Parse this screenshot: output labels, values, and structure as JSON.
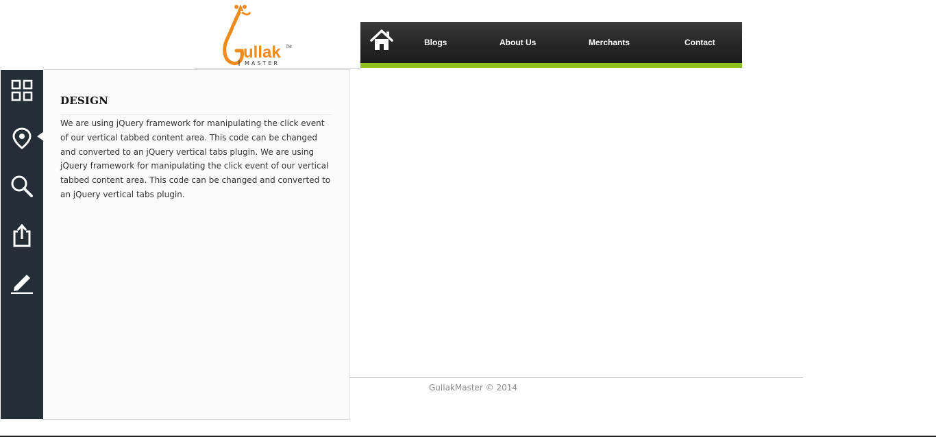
{
  "logo": {
    "wordmark": "ullak",
    "tagline": "MASTER",
    "trademark": "TM"
  },
  "nav": {
    "home_icon": "home-icon",
    "items": [
      {
        "label": "Blogs"
      },
      {
        "label": "About Us"
      },
      {
        "label": "Merchants"
      },
      {
        "label": "Contact"
      }
    ],
    "accent_color": "#8dc21f"
  },
  "sidebar": {
    "active_index": 1,
    "items": [
      {
        "icon": "grid-icon"
      },
      {
        "icon": "map-pin-icon"
      },
      {
        "icon": "search-icon"
      },
      {
        "icon": "share-icon"
      },
      {
        "icon": "pencil-icon"
      }
    ]
  },
  "panel": {
    "title": "DESIGN",
    "body": "We are using jQuery framework for manipulating the click event of our vertical tabbed content area. This code can be changed and converted to an jQuery vertical tabs plugin. We are using jQuery framework for manipulating the click event of our vertical tabbed content area. This code can be changed and converted to an jQuery vertical tabs plugin."
  },
  "footer": {
    "copyright": "GullakMaster © 2014"
  }
}
